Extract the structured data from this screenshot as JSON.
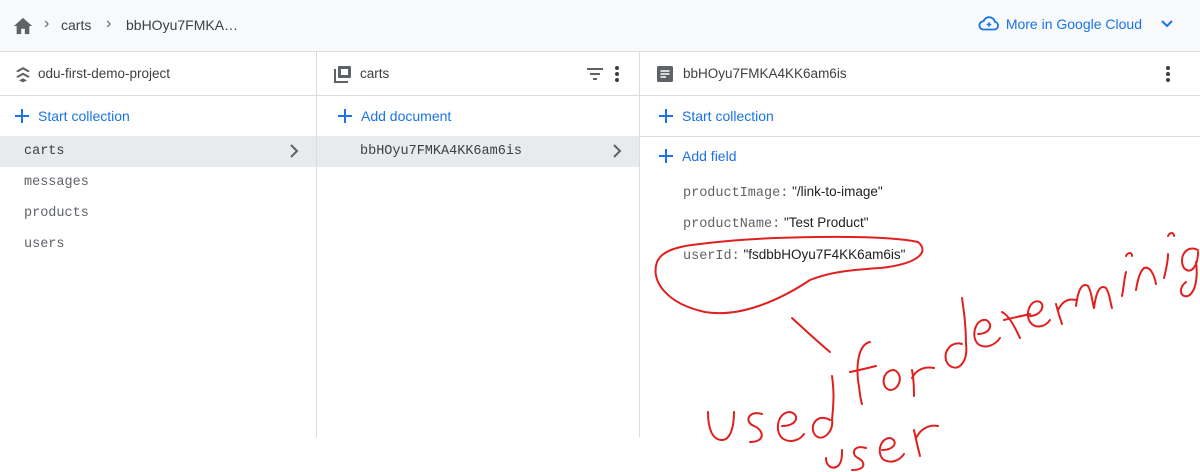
{
  "breadcrumb": {
    "items": [
      "carts",
      "bbHOyu7FMKA…"
    ]
  },
  "cloud_link": {
    "label": "More in Google Cloud"
  },
  "panel_project": {
    "title": "odu-first-demo-project",
    "action": "Start collection",
    "collections": [
      "carts",
      "messages",
      "products",
      "users"
    ],
    "selected": "carts"
  },
  "panel_collection": {
    "title": "carts",
    "action": "Add document",
    "documents": [
      "bbHOyu7FMKA4KK6am6is"
    ]
  },
  "panel_document": {
    "title": "bbHOyu7FMKA4KK6am6is",
    "action_collection": "Start collection",
    "action_field": "Add field",
    "fields": [
      {
        "key": "productImage:",
        "value": "\"/link-to-image\""
      },
      {
        "key": "productName:",
        "value": "\"Test Product\""
      },
      {
        "key": "userId:",
        "value": "\"fsdbbHOyu7F4KK6am6is\""
      }
    ]
  },
  "annotation": {
    "handwriting": "used for determining user"
  },
  "colors": {
    "accent": "#1a73e8",
    "ink": "#e0201f"
  }
}
